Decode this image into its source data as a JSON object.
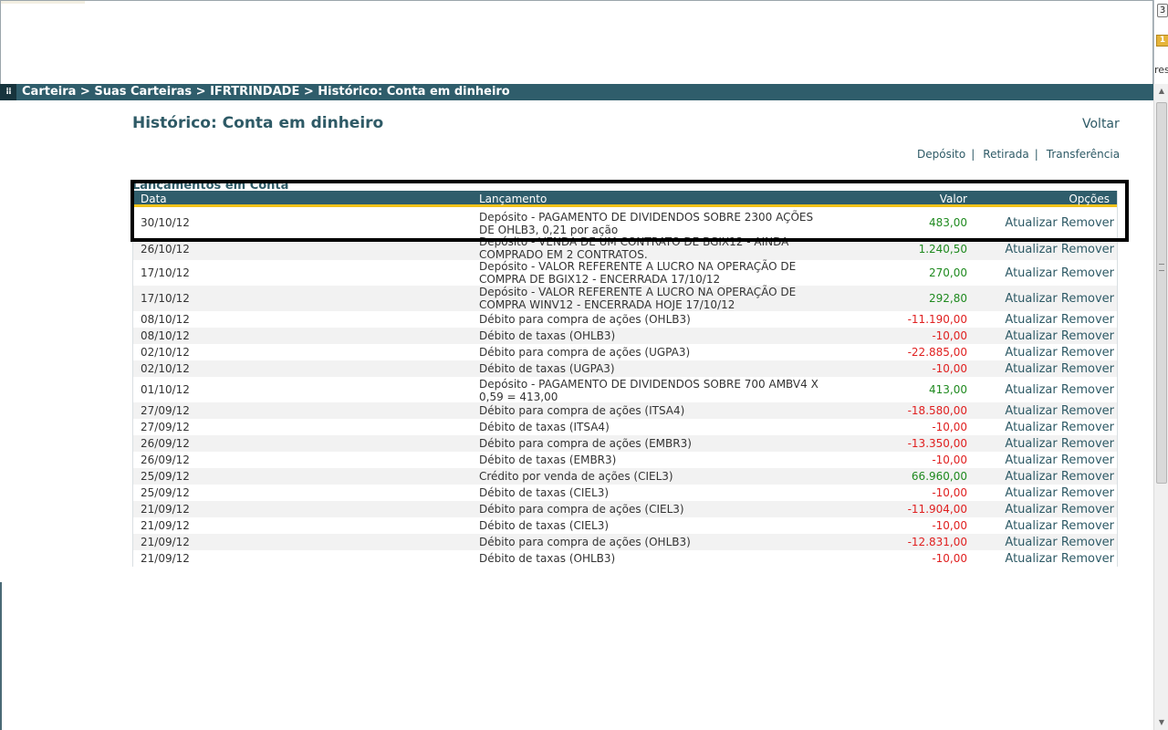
{
  "breadcrumb": {
    "text": "Carteira > Suas Carteiras > IFRTRINDADE > Histórico: Conta em dinheiro"
  },
  "header": {
    "title": "Histórico: Conta em dinheiro",
    "back_label": "Voltar"
  },
  "actions": {
    "deposit": "Depósito",
    "withdraw": "Retirada",
    "transfer": "Transferência",
    "separator": "|"
  },
  "section": {
    "title": "Lançamentos em Conta"
  },
  "table": {
    "columns": {
      "date": "Data",
      "entry": "Lançamento",
      "value": "Valor",
      "options": "Opções"
    },
    "option_update": "Atualizar",
    "option_remove": "Remover",
    "rows": [
      {
        "date": "30/10/12",
        "desc": "Depósito - PAGAMENTO DE DIVIDENDOS SOBRE 2300 AÇÕES DE OHLB3, 0,21 por ação",
        "value": "483,00",
        "sign": "pos"
      },
      {
        "date": "26/10/12",
        "desc": "Depósito - VENDA DE UM CONTRATO DE BGIX12 - AINDA COMPRADO EM 2 CONTRATOS.",
        "value": "1.240,50",
        "sign": "pos"
      },
      {
        "date": "17/10/12",
        "desc": "Depósito - VALOR REFERENTE A LUCRO NA OPERAÇÃO DE COMPRA DE BGIX12 - ENCERRADA 17/10/12",
        "value": "270,00",
        "sign": "pos"
      },
      {
        "date": "17/10/12",
        "desc": "Depósito - VALOR REFERENTE A LUCRO NA OPERAÇÃO DE COMPRA WINV12 - ENCERRADA HOJE 17/10/12",
        "value": "292,80",
        "sign": "pos"
      },
      {
        "date": "08/10/12",
        "desc": "Débito para compra de ações (OHLB3)",
        "value": "-11.190,00",
        "sign": "neg"
      },
      {
        "date": "08/10/12",
        "desc": "Débito de taxas (OHLB3)",
        "value": "-10,00",
        "sign": "neg"
      },
      {
        "date": "02/10/12",
        "desc": "Débito para compra de ações (UGPA3)",
        "value": "-22.885,00",
        "sign": "neg"
      },
      {
        "date": "02/10/12",
        "desc": "Débito de taxas (UGPA3)",
        "value": "-10,00",
        "sign": "neg"
      },
      {
        "date": "01/10/12",
        "desc": "Depósito - PAGAMENTO DE DIVIDENDOS SOBRE 700 AMBV4 X 0,59 = 413,00",
        "value": "413,00",
        "sign": "pos"
      },
      {
        "date": "27/09/12",
        "desc": "Débito para compra de ações (ITSA4)",
        "value": "-18.580,00",
        "sign": "neg"
      },
      {
        "date": "27/09/12",
        "desc": "Débito de taxas (ITSA4)",
        "value": "-10,00",
        "sign": "neg"
      },
      {
        "date": "26/09/12",
        "desc": "Débito para compra de ações (EMBR3)",
        "value": "-13.350,00",
        "sign": "neg"
      },
      {
        "date": "26/09/12",
        "desc": "Débito de taxas (EMBR3)",
        "value": "-10,00",
        "sign": "neg"
      },
      {
        "date": "25/09/12",
        "desc": "Crédito por venda de ações (CIEL3)",
        "value": "66.960,00",
        "sign": "pos"
      },
      {
        "date": "25/09/12",
        "desc": "Débito de taxas (CIEL3)",
        "value": "-10,00",
        "sign": "neg"
      },
      {
        "date": "21/09/12",
        "desc": "Débito para compra de ações (CIEL3)",
        "value": "-11.904,00",
        "sign": "neg"
      },
      {
        "date": "21/09/12",
        "desc": "Débito de taxas (CIEL3)",
        "value": "-10,00",
        "sign": "neg"
      },
      {
        "date": "21/09/12",
        "desc": "Débito para compra de ações (OHLB3)",
        "value": "-12.831,00",
        "sign": "neg"
      },
      {
        "date": "21/09/12",
        "desc": "Débito de taxas (OHLB3)",
        "value": "-10,00",
        "sign": "neg"
      }
    ]
  },
  "chrome": {
    "tab_count": "3",
    "badge": "1",
    "side_text": "res"
  },
  "colors": {
    "brand": "#2f5d6b",
    "accent": "#f2c219",
    "positive": "#1f8a1f",
    "negative": "#e02020"
  }
}
